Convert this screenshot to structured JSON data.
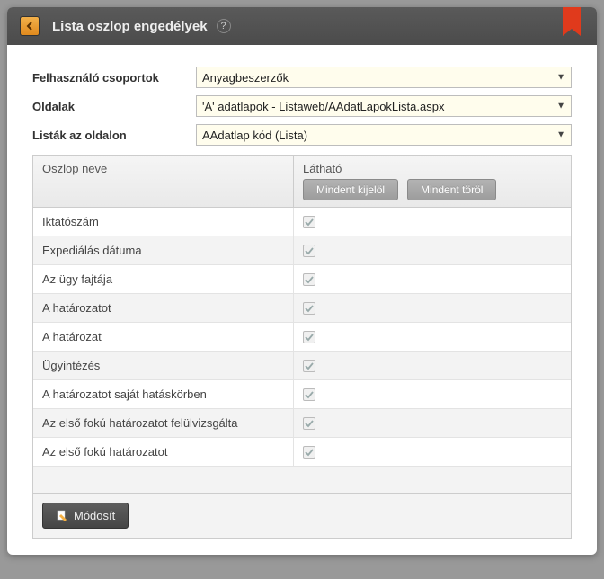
{
  "title": "Lista oszlop engedélyek",
  "form": {
    "userGroups": {
      "label": "Felhasználó csoportok",
      "value": "Anyagbeszerzők"
    },
    "pages": {
      "label": "Oldalak",
      "value": "'A' adatlapok - Listaweb/AAdatLapokLista.aspx"
    },
    "listsOnPage": {
      "label": "Listák az oldalon",
      "value": "AAdatlap kód (Lista)"
    }
  },
  "grid": {
    "header": {
      "columnName": "Oszlop neve",
      "visible": "Látható",
      "selectAll": "Mindent kijelöl",
      "clearAll": "Mindent töröl"
    },
    "rows": [
      {
        "name": "Iktatószám",
        "visible": true
      },
      {
        "name": "Expediálás dátuma",
        "visible": true
      },
      {
        "name": "Az ügy fajtája",
        "visible": true
      },
      {
        "name": "A határozatot",
        "visible": true
      },
      {
        "name": "A határozat",
        "visible": true
      },
      {
        "name": "Ügyintézés",
        "visible": true
      },
      {
        "name": "A határozatot saját hatáskörben",
        "visible": true
      },
      {
        "name": "Az első fokú határozatot felülvizsgálta",
        "visible": true
      },
      {
        "name": "Az első fokú határozatot",
        "visible": true
      }
    ]
  },
  "actions": {
    "modify": "Módosít"
  }
}
